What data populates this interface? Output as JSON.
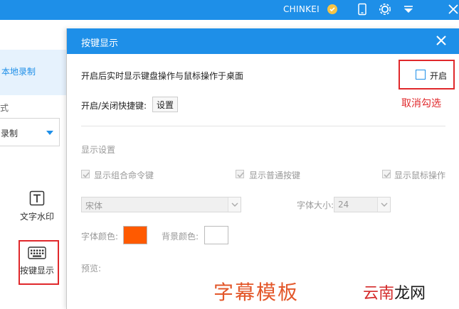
{
  "titlebar": {
    "brand": "CHINKEI",
    "bg_color": "#1e8fe8"
  },
  "background_app": {
    "side_tab_label": "本地录制",
    "section_fragment": "式",
    "select_value": "录制",
    "tools": [
      {
        "label": "文字水印",
        "icon": "text-watermark-icon"
      },
      {
        "label": "按键显示",
        "icon": "keyboard-icon"
      }
    ]
  },
  "dialog": {
    "title": "按键显示",
    "realtime_label": "开启后实时显示键盘操作与鼠标操作于桌面",
    "enable_checkbox_label": "开启",
    "enable_checked": false,
    "hotkey_label": "开启/关闭快捷键:",
    "hotkey_button": "设置",
    "annotation": "取消勾选",
    "display_settings_label": "显示设置",
    "options": [
      {
        "label": "显示组合命令键",
        "checked": true
      },
      {
        "label": "显示普通按键",
        "checked": true
      },
      {
        "label": "显示鼠标操作",
        "checked": true
      }
    ],
    "font_family": "宋体",
    "font_size_label": "字体大小:",
    "font_size_value": "24",
    "font_color_label": "字体颜色:",
    "font_color": "#ff5a00",
    "bg_color_label": "背景颜色:",
    "bg_color": "#ffffff",
    "preview_label": "预览:",
    "preview_text": "字幕模板"
  },
  "watermark": {
    "part1": "云南",
    "part2": "龙网"
  },
  "colors": {
    "accent": "#1e8fe8",
    "annotation_red": "#e0282b"
  }
}
